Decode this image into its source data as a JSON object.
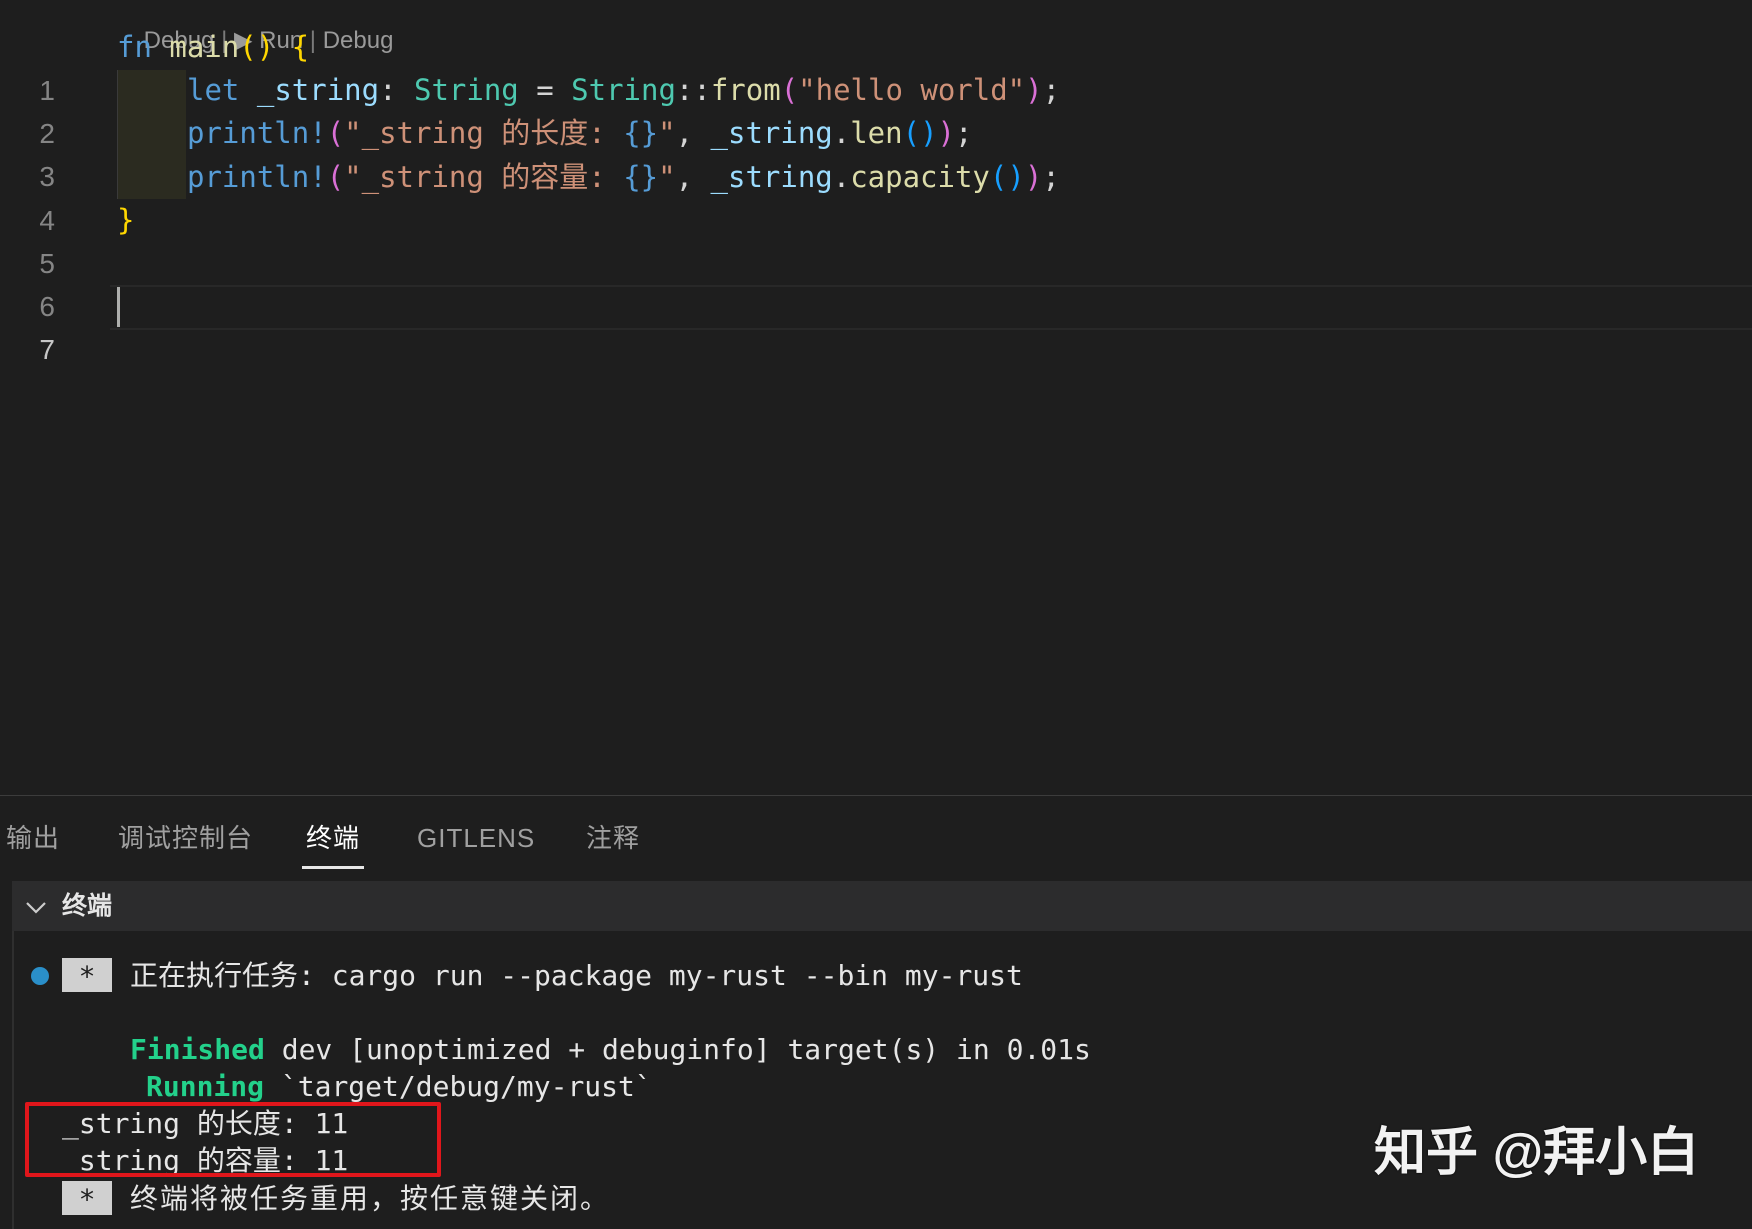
{
  "editor": {
    "codelens": {
      "debug": "Debug",
      "sep": " | ",
      "run_icon": "play-icon",
      "run": "Run",
      "debug2": "Debug"
    },
    "line_numbers": [
      "1",
      "2",
      "3",
      "4",
      "5",
      "6",
      "7"
    ],
    "active_line": "7",
    "lines": {
      "l1": {
        "kw": "fn",
        "name": "main",
        "paren_open": "(",
        "paren_close": ")",
        "brace": "{"
      },
      "l2": {
        "kw": "let",
        "var": "_string",
        "colon": ": ",
        "type1": "String",
        "eq": " = ",
        "type2": "String",
        "path": "::",
        "fn": "from",
        "p_open": "(",
        "str": "\"hello world\"",
        "p_close": ")",
        "semi": ";"
      },
      "l3": {
        "macro": "println!",
        "p_open": "(",
        "str": "\"_string 的长度: ",
        "fmt": "{}",
        "str_end": "\"",
        "comma": ", ",
        "var": "_string",
        "dot": ".",
        "method": "len",
        "m_open": "(",
        "m_close": ")",
        "p_close": ")",
        "semi": ";"
      },
      "l4": {
        "macro": "println!",
        "p_open": "(",
        "str": "\"_string 的容量: ",
        "fmt": "{}",
        "str_end": "\"",
        "comma": ", ",
        "var": "_string",
        "dot": ".",
        "method": "capacity",
        "m_open": "(",
        "m_close": ")",
        "p_close": ")",
        "semi": ";"
      },
      "l5": {
        "brace": "}"
      }
    }
  },
  "panel": {
    "tabs": [
      {
        "label": "输出"
      },
      {
        "label": "调试控制台"
      },
      {
        "label": "终端"
      },
      {
        "label": "GITLENS"
      },
      {
        "label": "注释"
      }
    ],
    "active_tab": "终端",
    "terminal_header": {
      "chevron": "chevron-down-icon",
      "title": "终端"
    },
    "terminal": {
      "task_star": "*",
      "task_line": "正在执行任务: cargo run --package my-rust --bin my-rust",
      "finished_word": "Finished",
      "finished_rest": " dev [unoptimized + debuginfo] target(s) in 0.01s",
      "running_word": "Running",
      "running_rest": " `target/debug/my-rust`",
      "out1": "_string 的长度: 11",
      "out2": "_string 的容量: 11",
      "reuse_star": "*",
      "reuse_line": "终端将被任务重用，按任意键关闭。"
    }
  },
  "watermark": "知乎 @拜小白",
  "colors": {
    "background": "#1e1e1e",
    "keyword": "#569cd6",
    "function": "#dcdcaa",
    "type": "#4ec9b0",
    "variable": "#9cdcfe",
    "string": "#ce9178",
    "terminal_green": "#23d18b",
    "highlight_box": "#e0161b"
  }
}
